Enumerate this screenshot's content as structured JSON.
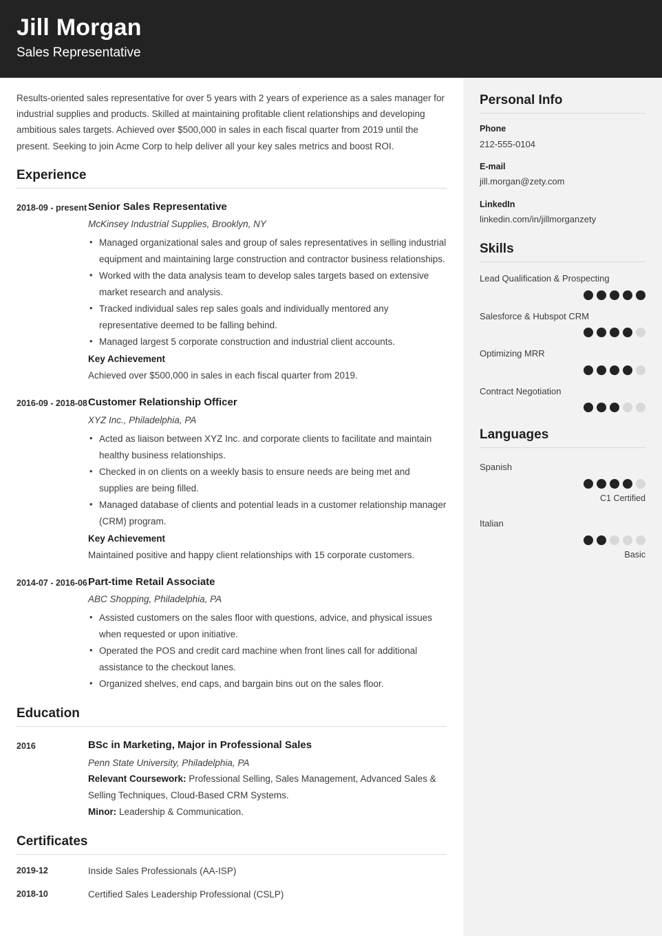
{
  "header": {
    "name": "Jill Morgan",
    "job_title": "Sales Representative",
    "bg_color": "#232323",
    "text_color": "#ffffff"
  },
  "summary": "Results-oriented sales representative for over 5 years with 2 years of experience as a sales manager for industrial supplies and products. Skilled at maintaining profitable client relationships and developing ambitious sales targets. Achieved over $500,000 in sales in each fiscal quarter from 2019 until the present. Seeking to join Acme Corp to help deliver all your key sales metrics and boost ROI.",
  "sections": {
    "experience_heading": "Experience",
    "education_heading": "Education",
    "certificates_heading": "Certificates"
  },
  "experience": [
    {
      "date": "2018-09 - present",
      "role": "Senior Sales Representative",
      "organization": "McKinsey Industrial Supplies, Brooklyn, NY",
      "bullets": [
        "Managed organizational sales and group of sales representatives in selling industrial equipment and maintaining large construction and contractor business relationships.",
        "Worked with the data analysis team to develop sales targets based on extensive market research and analysis.",
        "Tracked individual sales rep sales goals and individually mentored any representative deemed to be falling behind.",
        "Managed largest 5 corporate construction and industrial client accounts."
      ],
      "achievement_label": "Key Achievement",
      "achievement_text": "Achieved over $500,000 in sales in each fiscal quarter from 2019."
    },
    {
      "date": "2016-09 - 2018-08",
      "role": "Customer Relationship Officer",
      "organization": "XYZ Inc., Philadelphia, PA",
      "bullets": [
        "Acted as liaison between XYZ Inc. and corporate clients to facilitate and maintain healthy business relationships.",
        "Checked in on clients on a weekly basis to ensure needs are being met and supplies are being filled.",
        "Managed database of clients and potential leads in a customer relationship manager (CRM) program."
      ],
      "achievement_label": "Key Achievement",
      "achievement_text": "Maintained positive and happy client relationships with 15 corporate customers."
    },
    {
      "date": "2014-07 - 2016-06",
      "role": "Part-time Retail Associate",
      "organization": "ABC Shopping, Philadelphia, PA",
      "bullets": [
        "Assisted customers on the sales floor with questions, advice, and physical issues when requested or upon initiative.",
        "Operated the POS and credit card machine when front lines call for additional assistance to the checkout lanes.",
        "Organized shelves, end caps, and bargain bins out on the sales floor."
      ],
      "achievement_label": "",
      "achievement_text": ""
    }
  ],
  "education": [
    {
      "date": "2016",
      "degree": "BSc in Marketing, Major in Professional Sales",
      "school": "Penn State University, Philadelphia, PA",
      "coursework_label": "Relevant Coursework:",
      "coursework_text": " Professional Selling, Sales Management, Advanced Sales & Selling Techniques, Cloud-Based CRM Systems.",
      "minor_label": "Minor:",
      "minor_text": " Leadership & Communication."
    }
  ],
  "certificates": [
    {
      "date": "2019-12",
      "name": "Inside Sales Professionals (AA-ISP)"
    },
    {
      "date": "2018-10",
      "name": "Certified Sales Leadership Professional (CSLP)"
    }
  ],
  "sidebar": {
    "personal_info": {
      "heading": "Personal Info",
      "items": [
        {
          "label": "Phone",
          "value": "212-555-0104"
        },
        {
          "label": "E-mail",
          "value": "jill.morgan@zety.com"
        },
        {
          "label": "LinkedIn",
          "value": "linkedin.com/in/jillmorganzety"
        }
      ]
    },
    "skills": {
      "heading": "Skills",
      "max_rating": 5,
      "items": [
        {
          "label": "Lead Qualification & Prospecting",
          "rating": 5
        },
        {
          "label": "Salesforce & Hubspot CRM",
          "rating": 4
        },
        {
          "label": "Optimizing MRR",
          "rating": 4
        },
        {
          "label": "Contract Negotiation",
          "rating": 3
        }
      ]
    },
    "languages": {
      "heading": "Languages",
      "max_rating": 5,
      "items": [
        {
          "label": "Spanish",
          "rating": 4,
          "note": "C1 Certified"
        },
        {
          "label": "Italian",
          "rating": 2,
          "note": "Basic"
        }
      ]
    }
  },
  "colors": {
    "header_bg": "#232323",
    "sidebar_bg": "#f2f2f2",
    "rule": "#d8d8d8",
    "dot_on": "#232323",
    "dot_off": "#d8d8d8",
    "body_text": "#3c3c3c"
  }
}
